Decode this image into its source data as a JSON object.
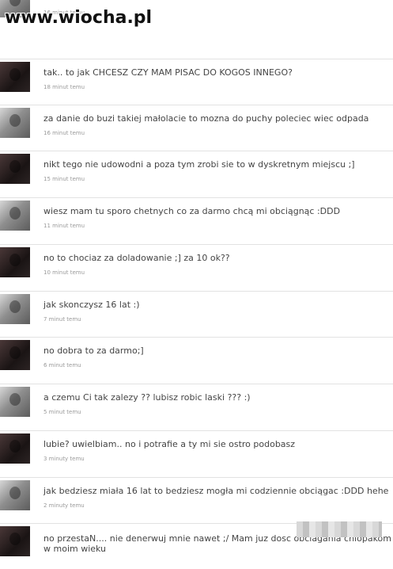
{
  "watermark": "www.wiocha.pl",
  "messages": [
    {
      "text": "",
      "time": "16 minut temu",
      "avatar": "light"
    },
    {
      "text": "tak.. to jak CHCESZ CZY MAM PISAC DO KOGOS INNEGO?",
      "time": "18 minut temu",
      "avatar": "dark"
    },
    {
      "text": "za danie do buzi takiej małolacie to mozna do puchy poleciec wiec odpada",
      "time": "16 minut temu",
      "avatar": "light"
    },
    {
      "text": "nikt tego nie udowodni a poza tym zrobi sie to w dyskretnym miejscu ;]",
      "time": "15 minut temu",
      "avatar": "dark"
    },
    {
      "text": "wiesz mam tu sporo chetnych co za darmo chcą mi obciągnąc :DDD",
      "time": "11 minut temu",
      "avatar": "light"
    },
    {
      "text": "no to chociaz za doladowanie ;] za 10 ok??",
      "time": "10 minut temu",
      "avatar": "dark"
    },
    {
      "text": "jak skonczysz 16 lat :)",
      "time": "7 minut temu",
      "avatar": "light"
    },
    {
      "text": "no dobra to za darmo;]",
      "time": "6 minut temu",
      "avatar": "dark"
    },
    {
      "text": "a czemu Ci tak zalezy ?? lubisz robic laski ??? :)",
      "time": "5 minut temu",
      "avatar": "light"
    },
    {
      "text": "lubie? uwielbiam.. no i potrafie a ty mi sie ostro podobasz",
      "time": "3 minuty temu",
      "avatar": "dark"
    },
    {
      "text": "jak bedziesz miała 16 lat to bedziesz mogła mi codziennie obciągac :DDD hehe",
      "time": "2 minuty temu",
      "avatar": "light"
    },
    {
      "text": "no przestaN.... nie denerwuj mnie nawet ;/ Mam juz dosc obciagania chlopakom w moim wieku",
      "time": "",
      "avatar": "dark"
    }
  ]
}
